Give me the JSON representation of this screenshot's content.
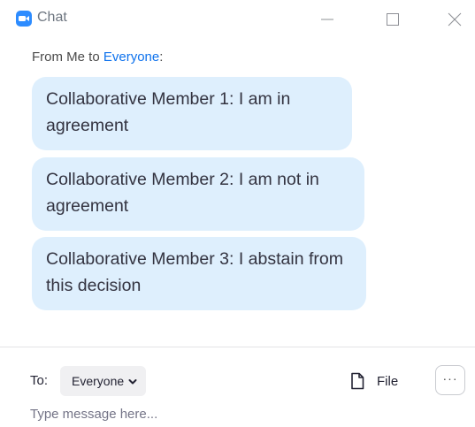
{
  "window": {
    "title": "Chat"
  },
  "icons": {
    "app": "zoom-chat-icon",
    "minimize": "minimize-icon",
    "maximize": "maximize-icon",
    "close": "close-icon",
    "file": "file-icon",
    "more": "more-options-icon",
    "dropdown": "chevron-down-icon"
  },
  "colors": {
    "accent": "#2D8CFF",
    "recipient_link": "#0E72ED",
    "bubble_bg": "#DEEFFD"
  },
  "chat": {
    "from_prefix": "From Me to ",
    "to_name": "Everyone",
    "from_suffix": ":",
    "messages": [
      {
        "text": "Collaborative Member 1: I am in agreement"
      },
      {
        "text": "Collaborative Member 2: I am not in agreement"
      },
      {
        "text": "Collaborative Member 3: I abstain from this decision"
      }
    ]
  },
  "compose": {
    "to_label": "To:",
    "recipient": "Everyone",
    "file_label": "File",
    "more_label": "···",
    "placeholder": "Type message here..."
  }
}
